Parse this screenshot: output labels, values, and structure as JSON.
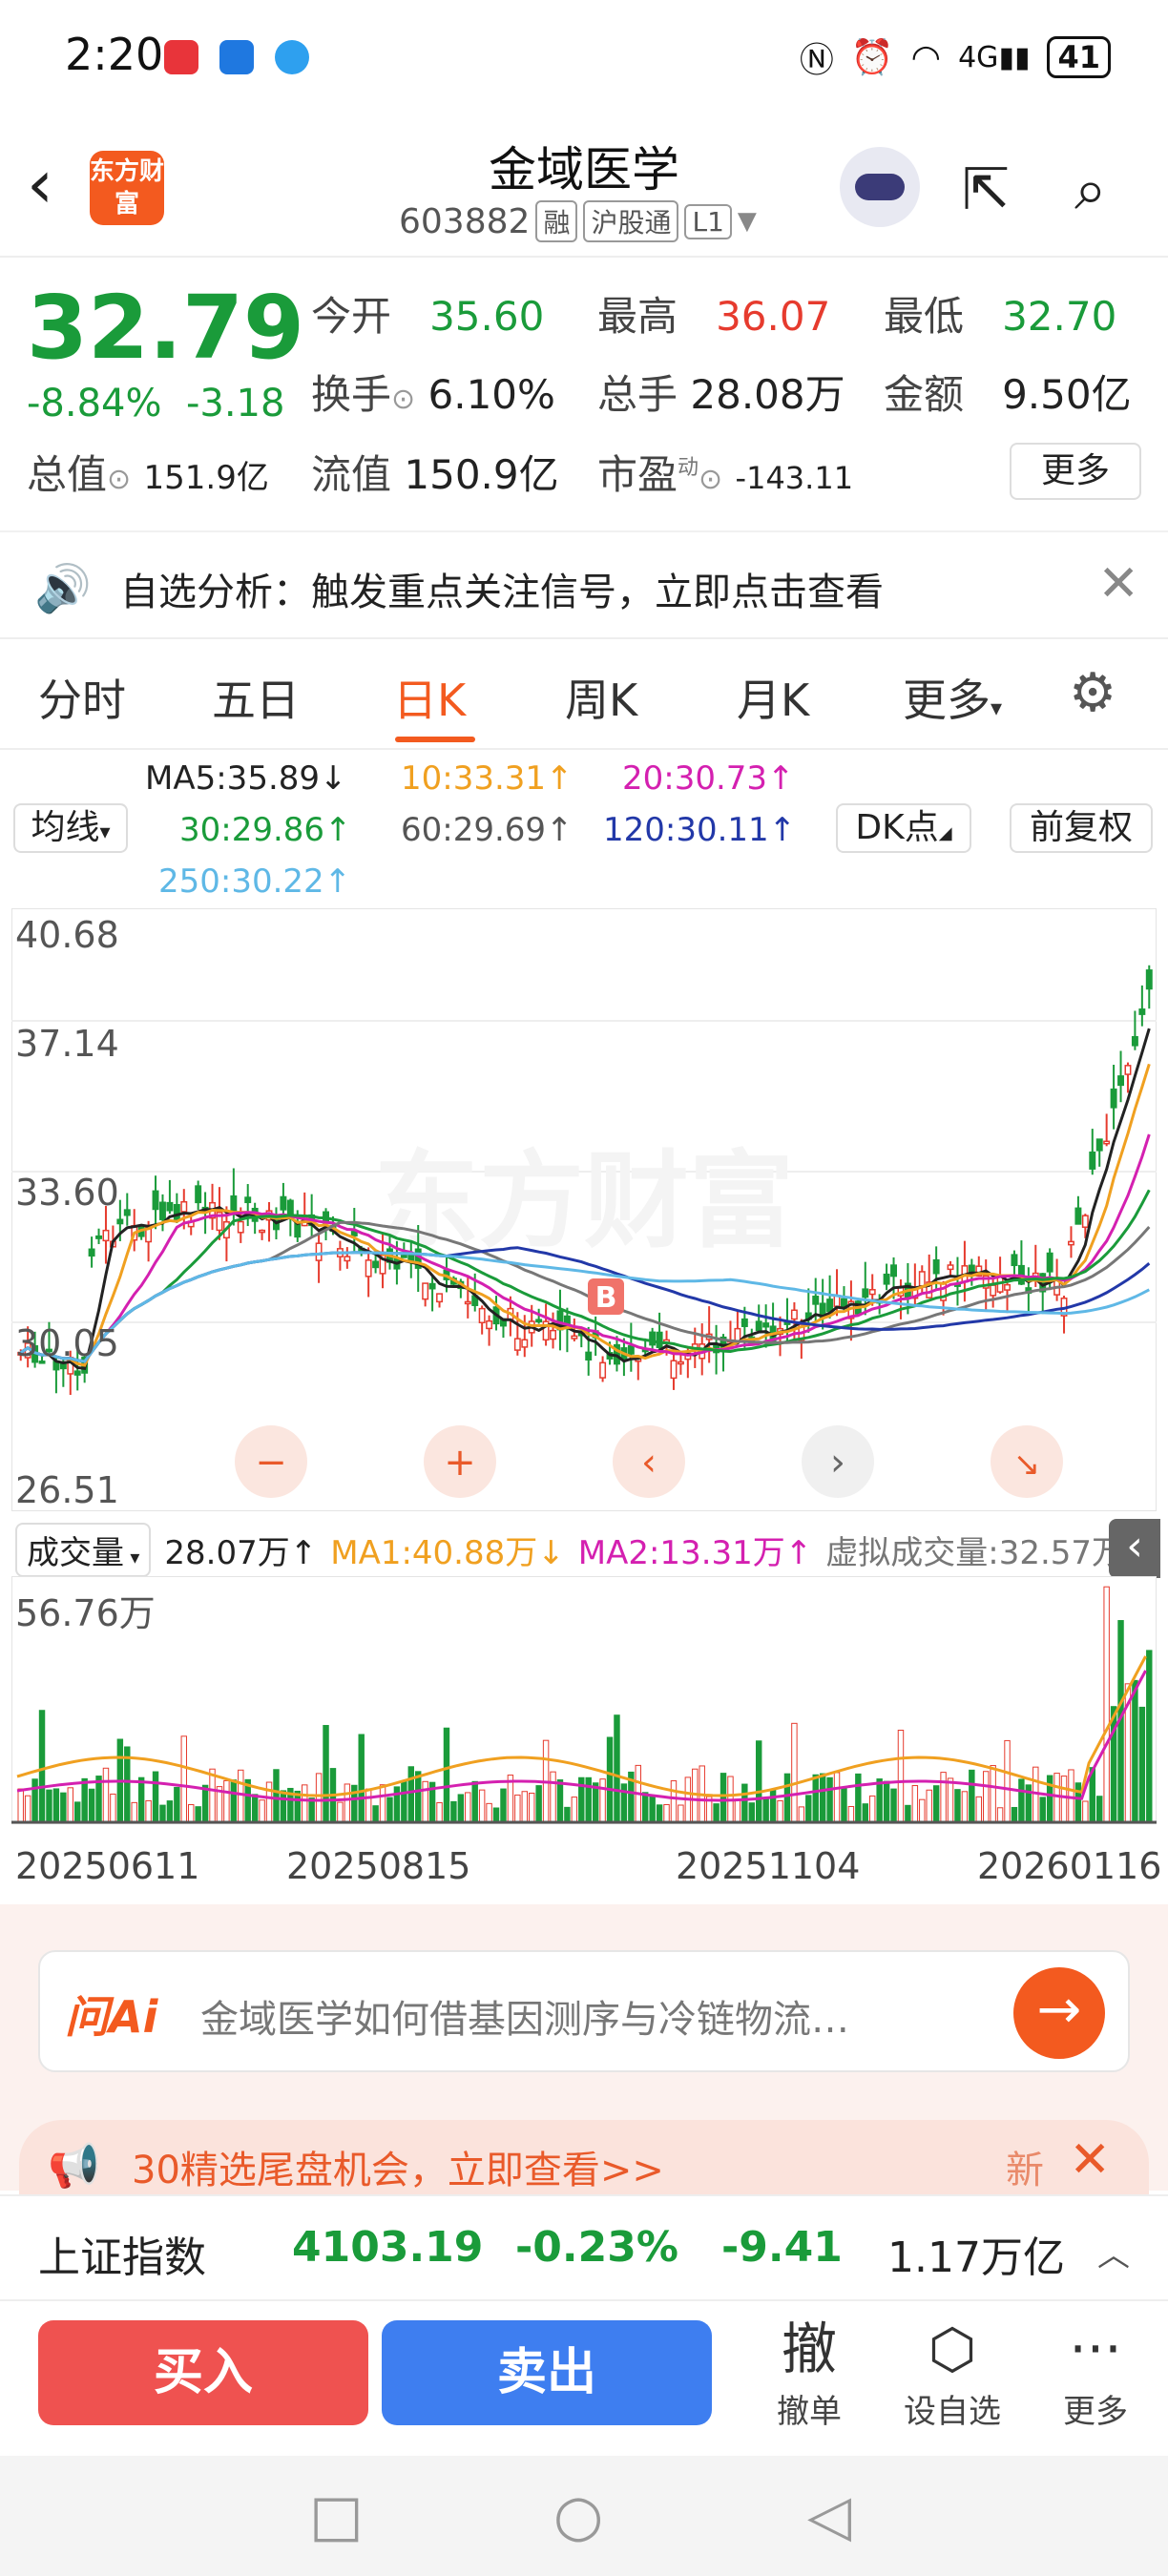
{
  "status": {
    "time": "2:20",
    "battery": "41",
    "network": "4G"
  },
  "header": {
    "title": "金域医学",
    "code": "603882",
    "tags": [
      "融",
      "沪股通",
      "L1"
    ],
    "logo_text": "东方财富"
  },
  "quote": {
    "price": "32.79",
    "pct": "-8.84%",
    "change": "-3.18",
    "open_label": "今开",
    "open": "35.60",
    "high_label": "最高",
    "high": "36.07",
    "low_label": "最低",
    "low": "32.70",
    "turnover_label": "换手",
    "turnover": "6.10%",
    "volume_label": "总手",
    "volume": "28.08万",
    "amount_label": "金额",
    "amount": "9.50亿",
    "mcap_label": "总值",
    "mcap": "151.9亿",
    "float_label": "流值",
    "float": "150.9亿",
    "pe_label": "市盈",
    "pe_sup": "动",
    "pe": "-143.11",
    "more": "更多"
  },
  "notice": {
    "text": "自选分析：触发重点关注信号，立即点击查看"
  },
  "tabs": [
    "分时",
    "五日",
    "日K",
    "周K",
    "月K",
    "更多"
  ],
  "ma_legend": {
    "ma5": "MA5:35.89↓",
    "ma10": "10:33.31↑",
    "ma20": "20:30.73↑",
    "ma30": "30:29.86↑",
    "ma60": "60:29.69↑",
    "ma120": "120:30.11↑",
    "ma250": "250:30.22↑",
    "junxian": "均线",
    "dk": "DK点",
    "fuquan": "前复权"
  },
  "chart": {
    "y_labels": [
      "40.68",
      "37.14",
      "33.60",
      "30.05",
      "26.51"
    ],
    "marker": "B",
    "vol_max": "56.76万",
    "x_labels": [
      "20250611",
      "20250815",
      "20251104",
      "20260116"
    ],
    "watermark": "东方财富"
  },
  "volume_legend": {
    "selector": "成交量",
    "value": "28.07万↑",
    "ma1": "MA1:40.88万↓",
    "ma2": "MA2:13.31万↑",
    "virtual": "虚拟成交量:32.57万"
  },
  "ai": {
    "logo": "问Ai",
    "text": "金域医学如何借基因测序与冷链物流…"
  },
  "promo": {
    "text": "30精选尾盘机会，立即查看>>",
    "badge": "新"
  },
  "index": {
    "name": "上证指数",
    "value": "4103.19",
    "pct": "-0.23%",
    "change": "-9.41",
    "amount": "1.17万亿"
  },
  "trade": {
    "buy": "买入",
    "sell": "卖出",
    "cancel_icon": "撤",
    "cancel": "撤单",
    "watch": "设自选",
    "more": "更多"
  },
  "colors": {
    "up": "#e63b2e",
    "down": "#1a9b3a",
    "accent": "#f35a1f",
    "sell": "#3e7ef0",
    "buy": "#ef5250"
  }
}
